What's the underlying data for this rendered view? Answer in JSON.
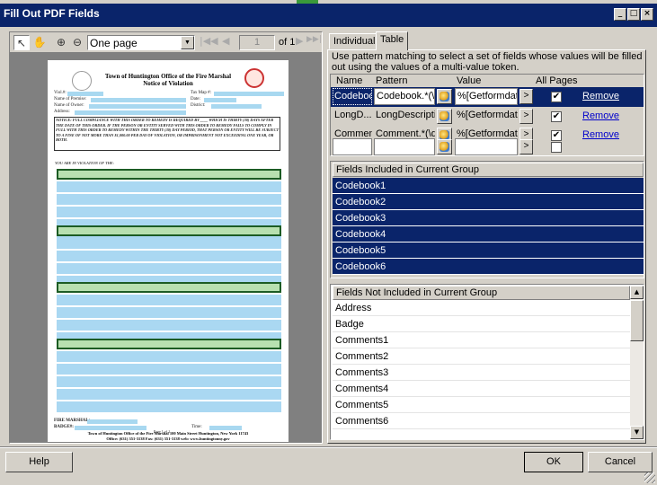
{
  "window": {
    "title": "Fill Out PDF Fields",
    "controls": {
      "minimize": "_",
      "maximize": "□",
      "close": "×"
    }
  },
  "pdf_viewer": {
    "tools": [
      {
        "name": "select-tool-icon",
        "glyph": "↖"
      },
      {
        "name": "hand-tool-icon",
        "glyph": "✋"
      },
      {
        "name": "zoom-in-icon",
        "glyph": "⊕"
      },
      {
        "name": "zoom-out-icon",
        "glyph": "⊖"
      }
    ],
    "zoom": "One page",
    "page_number": "1",
    "page_total": "of 1",
    "nav": {
      "first": "|◀◀",
      "prev": "◀",
      "next": "▶",
      "last": "▶▶|"
    }
  },
  "document": {
    "org_title": "Town of Huntington Office of the Fire Marshal",
    "doc_title": "Notice of Violation",
    "labels": {
      "viol": "Viol.#:",
      "tax_map": "Tax Map #:",
      "premise": "Name of Premise:",
      "date": "Date:",
      "owner": "Name of Owner:",
      "district": "District:",
      "address": "Address:"
    },
    "notice": "NOTICE: FULL COMPLIANCE WITH THIS ORDER TO REMEDY IS REQUIRED BY ____ WHICH IS THIRTY (30) DAYS AFTER THE DATE OF THIS ORDER. IF THE PERSON OR ENTITY SERVED WITH THIS ORDER TO REMEDY FAILS TO COMPLY IN FULL WITH THIS ORDER TO REMEDY WITHIN THE THIRTY (30) DAY PERIOD, THAT PERSON OR ENTITY WILL BE SUBJECT TO A FINE OF NOT MORE THAN $1,000.00 PER DAY OF VIOLATION, OR IMPRISONMENT NOT EXCEEDING ONE YEAR, OR BOTH.",
    "violation_header": "YOU ARE IN VIOLATION OF THE:",
    "fire_marshal_label": "FIRE MARSHAL:",
    "badge_label": "BADGE#:",
    "time_label": "Time:",
    "footer_line1": "Town of Huntington Office of the Fire Marshal 100 Main Street Huntington, New York 11743",
    "footer_line2": "Office: (631) 351-3138  Fax: (631) 351-3138  web: www.huntingtonny.gov",
    "footer_page": "Page 1 of 1",
    "field_color": "#a8d8f0",
    "highlight_color": "#1c5c24"
  },
  "tabs": [
    {
      "label": "Individual",
      "active": false
    },
    {
      "label": "Table",
      "active": true
    }
  ],
  "description": "Use pattern matching to select a set of fields whose values will be filled out using the values of a multi-value token.",
  "pattern_table": {
    "headers": {
      "name": "Name",
      "pattern": "Pattern",
      "value": "Value",
      "all_pages": "All Pages"
    },
    "rows": [
      {
        "name": "Codebook",
        "pattern": "Codebook.*(\\...",
        "value": "%[Getformdata...",
        "arrow": ">",
        "checked": "✔",
        "remove": "Remove",
        "selected": true
      },
      {
        "name": "LongD...",
        "pattern": "LongDescripti...",
        "value": "%[Getformdata...",
        "arrow": ">",
        "checked": "✔",
        "remove": "Remove",
        "selected": false
      },
      {
        "name": "Comment",
        "pattern": "Comment.*(\\d+)",
        "value": "%[Getformdata...",
        "arrow": ">",
        "checked": "✔",
        "remove": "Remove",
        "selected": false
      },
      {
        "name": "",
        "pattern": "",
        "value": "",
        "arrow": ">",
        "checked": "",
        "remove": "",
        "selected": false
      }
    ]
  },
  "included": {
    "header": "Fields Included in Current Group",
    "items": [
      "Codebook1",
      "Codebook2",
      "Codebook3",
      "Codebook4",
      "Codebook5",
      "Codebook6"
    ]
  },
  "not_included": {
    "header": "Fields Not Included in Current Group",
    "items": [
      "Address",
      "Badge",
      "Comments1",
      "Comments2",
      "Comments3",
      "Comments4",
      "Comments5",
      "Comments6"
    ]
  },
  "buttons": {
    "help": "Help",
    "ok": "OK",
    "cancel": "Cancel"
  }
}
